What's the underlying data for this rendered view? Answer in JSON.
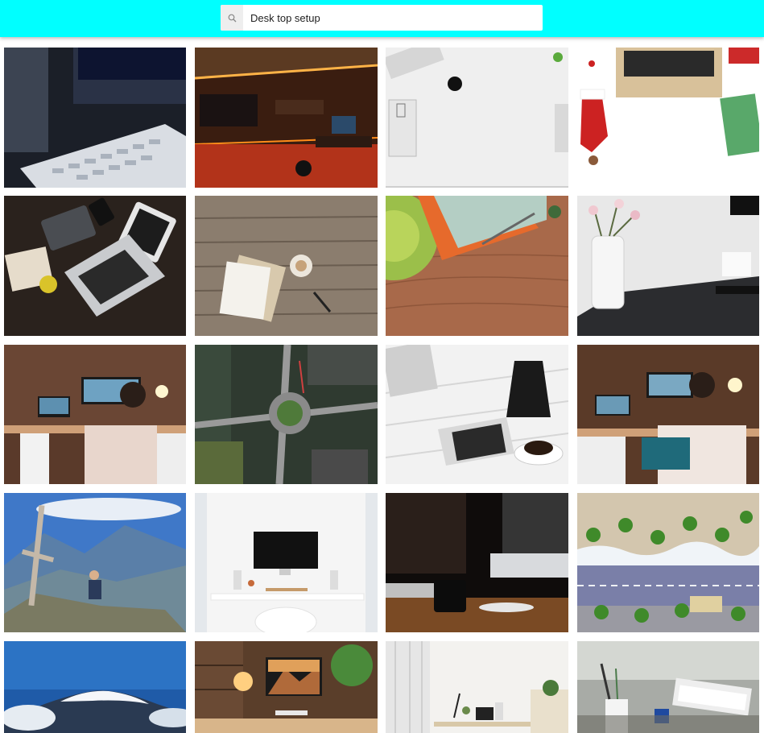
{
  "search": {
    "value": "Desk top setup",
    "icon": "search-icon"
  },
  "colors": {
    "header_bg": "#00ffff",
    "search_icon_bg": "#eeeeee"
  },
  "results": [
    {
      "name": "photo-imac-keyboard"
    },
    {
      "name": "photo-orange-led-game-room"
    },
    {
      "name": "photo-white-desk-flatlay-coffee"
    },
    {
      "name": "photo-christmas-laptop-flatlay"
    },
    {
      "name": "photo-laptop-tablet-dark-desk"
    },
    {
      "name": "photo-wood-paper-coffee"
    },
    {
      "name": "photo-green-cup-paper-wood"
    },
    {
      "name": "photo-flowers-vase-desk"
    },
    {
      "name": "photo-man-phone-desk-setup"
    },
    {
      "name": "photo-aerial-roundabout"
    },
    {
      "name": "photo-moka-pot-tablet-coffee"
    },
    {
      "name": "photo-man-desk-lamp"
    },
    {
      "name": "photo-mountain-cross-hiker"
    },
    {
      "name": "photo-white-imac-room"
    },
    {
      "name": "photo-imac-mug-dark"
    },
    {
      "name": "photo-aerial-beach-palms"
    },
    {
      "name": "photo-snowy-peak-clouds"
    },
    {
      "name": "photo-cozy-desk-plants"
    },
    {
      "name": "photo-minimal-white-room"
    },
    {
      "name": "photo-pencil-cup-desk"
    }
  ]
}
